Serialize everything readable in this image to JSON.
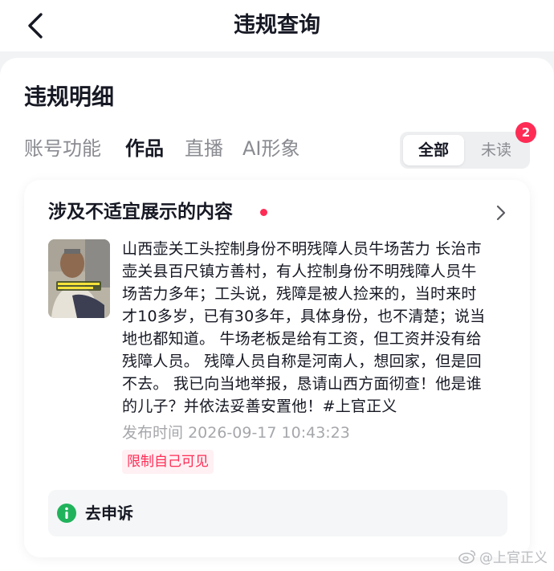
{
  "header": {
    "title": "违规查询"
  },
  "section": {
    "title": "违规明细"
  },
  "tabs": [
    {
      "label": "账号功能"
    },
    {
      "label": "作品"
    },
    {
      "label": "直播"
    },
    {
      "label": "AI形象"
    }
  ],
  "filter": {
    "all_label": "全部",
    "unread_label": "未读",
    "unread_count": "2"
  },
  "card": {
    "title": "涉及不适宜展示的内容",
    "thumbnail_caption": "我已向当地举报 恳请山西方面彻查 他是谁的儿子",
    "description_lines": [
      "山西壶关工头控制身份不明残障人员牛场苦力 长治市",
      "壶关县百尺镇方善村，有人控制身份不明残障人员牛",
      "场苦力多年；工头说，残障是被人捡来的，当时来时",
      "才10多岁，已有30多年，具体身份，也不清楚；说当",
      "地也都知道。 牛场老板是给有工资，但工资并没有给",
      "残障人员。 残障人员自称是河南人，想回家，但是回",
      "不去。 我已向当地举报，恳请山西方面彻查！他是谁",
      "的儿子？并依法妥善安置他！#上官正义"
    ],
    "publish_label": "发布时间",
    "publish_time": "2026-09-17 10:43:23",
    "restriction_tag": "限制自己可见",
    "appeal_label": "去申诉"
  },
  "watermark": {
    "text": "@上官正义"
  },
  "colors": {
    "accent": "#fe2c55",
    "appeal_icon": "#21b35c",
    "muted": "#8a8b91"
  }
}
